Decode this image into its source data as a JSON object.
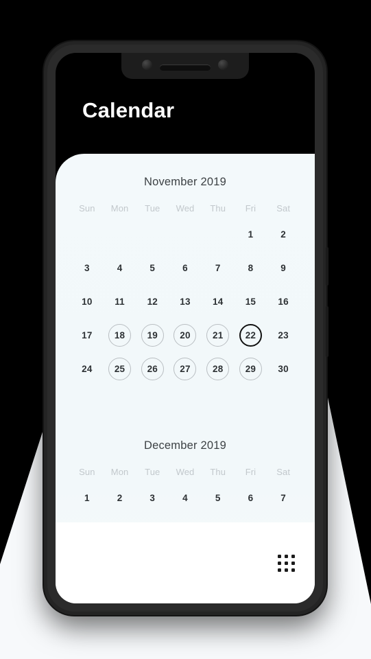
{
  "app": {
    "title": "Calendar",
    "title_color": "#ffffff"
  },
  "theme": {
    "background_dark": "#000000",
    "background_light": "#f7f9fb",
    "card_background": "#f3f9fb",
    "footer_background": "#ffffff",
    "day_text": "#2d3134",
    "weekday_text": "#c2c8cc",
    "month_title": "#3d4245",
    "ring_color": "#b9bec2",
    "today_ring_color": "#111111"
  },
  "weekdays": [
    "Sun",
    "Mon",
    "Tue",
    "Wed",
    "Thu",
    "Fri",
    "Sat"
  ],
  "months": [
    {
      "title": "November 2019",
      "weeks": [
        [
          {
            "label": "",
            "state": "empty"
          },
          {
            "label": "",
            "state": "empty"
          },
          {
            "label": "",
            "state": "empty"
          },
          {
            "label": "",
            "state": "empty"
          },
          {
            "label": "",
            "state": "empty"
          },
          {
            "label": "1",
            "state": "plain"
          },
          {
            "label": "2",
            "state": "plain"
          }
        ],
        [
          {
            "label": "3",
            "state": "plain"
          },
          {
            "label": "4",
            "state": "plain"
          },
          {
            "label": "5",
            "state": "plain"
          },
          {
            "label": "6",
            "state": "plain"
          },
          {
            "label": "7",
            "state": "plain"
          },
          {
            "label": "8",
            "state": "plain"
          },
          {
            "label": "9",
            "state": "plain"
          }
        ],
        [
          {
            "label": "10",
            "state": "plain"
          },
          {
            "label": "11",
            "state": "plain"
          },
          {
            "label": "12",
            "state": "plain"
          },
          {
            "label": "13",
            "state": "plain"
          },
          {
            "label": "14",
            "state": "plain"
          },
          {
            "label": "15",
            "state": "plain"
          },
          {
            "label": "16",
            "state": "plain"
          }
        ],
        [
          {
            "label": "17",
            "state": "plain"
          },
          {
            "label": "18",
            "state": "ring"
          },
          {
            "label": "19",
            "state": "ring"
          },
          {
            "label": "20",
            "state": "ring"
          },
          {
            "label": "21",
            "state": "ring"
          },
          {
            "label": "22",
            "state": "today"
          },
          {
            "label": "23",
            "state": "plain"
          }
        ],
        [
          {
            "label": "24",
            "state": "plain"
          },
          {
            "label": "25",
            "state": "ring"
          },
          {
            "label": "26",
            "state": "ring"
          },
          {
            "label": "27",
            "state": "ring"
          },
          {
            "label": "28",
            "state": "ring"
          },
          {
            "label": "29",
            "state": "ring"
          },
          {
            "label": "30",
            "state": "plain"
          }
        ]
      ]
    },
    {
      "title": "December 2019",
      "weeks": [
        [
          {
            "label": "1",
            "state": "plain"
          },
          {
            "label": "2",
            "state": "plain"
          },
          {
            "label": "3",
            "state": "plain"
          },
          {
            "label": "4",
            "state": "plain"
          },
          {
            "label": "5",
            "state": "plain"
          },
          {
            "label": "6",
            "state": "plain"
          },
          {
            "label": "7",
            "state": "plain"
          }
        ]
      ]
    }
  ],
  "footer": {
    "apps_icon": "apps-grid-icon",
    "apps_icon_dots": 9
  }
}
